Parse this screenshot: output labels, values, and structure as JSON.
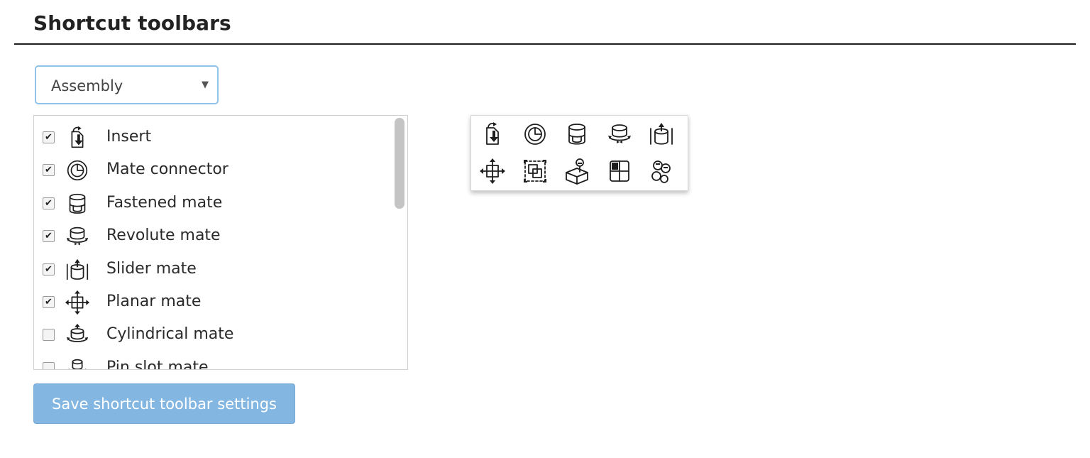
{
  "section": {
    "title": "Shortcut toolbars"
  },
  "toolbar_select": {
    "selected": "Assembly"
  },
  "features": [
    {
      "label": "Insert",
      "checked": true,
      "icon": "insert-icon"
    },
    {
      "label": "Mate connector",
      "checked": true,
      "icon": "mate-connector-icon"
    },
    {
      "label": "Fastened mate",
      "checked": true,
      "icon": "fastened-mate-icon"
    },
    {
      "label": "Revolute mate",
      "checked": true,
      "icon": "revolute-mate-icon"
    },
    {
      "label": "Slider mate",
      "checked": true,
      "icon": "slider-mate-icon"
    },
    {
      "label": "Planar mate",
      "checked": true,
      "icon": "planar-mate-icon"
    },
    {
      "label": "Cylindrical mate",
      "checked": false,
      "icon": "cylindrical-mate-icon"
    },
    {
      "label": "Pin slot mate",
      "checked": false,
      "icon": "pin-slot-mate-icon"
    }
  ],
  "preview_icons": [
    "insert-icon",
    "mate-connector-icon",
    "fastened-mate-icon",
    "revolute-mate-icon",
    "slider-mate-icon",
    "planar-mate-icon",
    "group-icon",
    "tangent-mate-icon",
    "replicate-icon",
    "gear-relation-icon"
  ],
  "save_button": {
    "label": "Save shortcut toolbar settings"
  },
  "colors": {
    "select_border": "#8fc3ea",
    "button_bg": "#83b6e1",
    "button_text": "#ffffff"
  }
}
